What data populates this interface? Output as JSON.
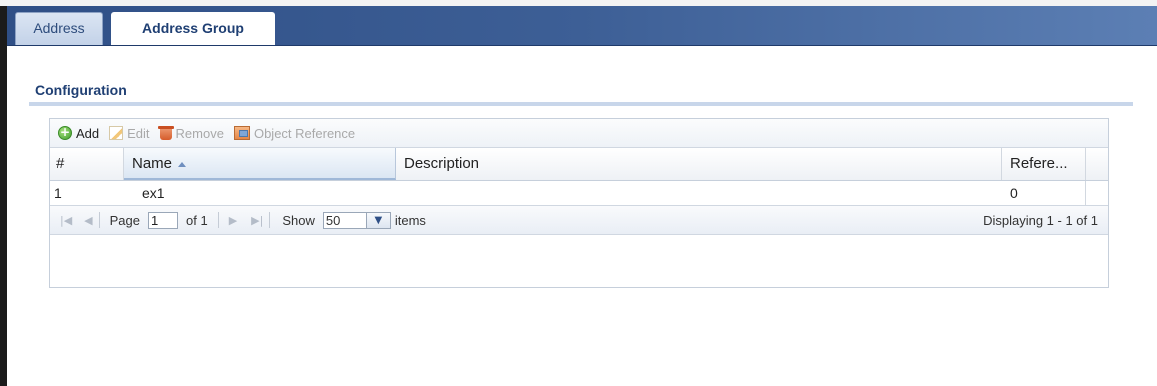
{
  "tabs": [
    {
      "label": "Address"
    },
    {
      "label": "Address Group"
    }
  ],
  "section": {
    "title": "Configuration"
  },
  "toolbar": {
    "add_label": "Add",
    "edit_label": "Edit",
    "remove_label": "Remove",
    "object_reference_label": "Object Reference"
  },
  "table": {
    "columns": [
      "#",
      "Name",
      "Description",
      "Refere..."
    ],
    "sort": {
      "column": "Name",
      "direction": "ascending"
    },
    "rows": [
      {
        "num": "1",
        "name": "ex1",
        "description": "",
        "references": "0"
      }
    ]
  },
  "pager": {
    "page_label": "Page",
    "page_value": "1",
    "of_label": "of 1",
    "show_label": "Show",
    "page_size": "50",
    "items_label": "items",
    "displaying": "Displaying 1 - 1 of 1"
  },
  "colors": {
    "tab_bar": "#3d5f96",
    "accent_text": "#1f3f73",
    "add_icon": "#3f9e2b",
    "disabled_text": "#a9a9a9"
  }
}
